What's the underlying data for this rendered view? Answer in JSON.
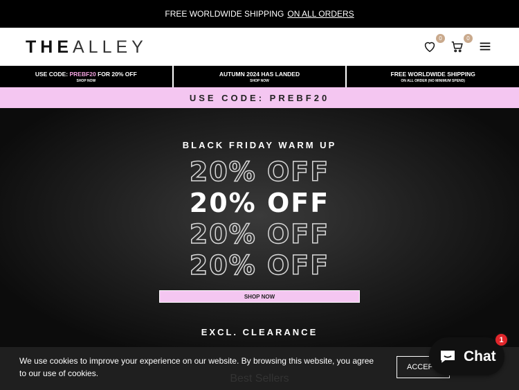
{
  "announcement": {
    "text": "FREE WORLDWIDE SHIPPING",
    "link": "ON ALL ORDERS"
  },
  "header": {
    "logo_bold": "THE",
    "logo_light": "ALLEY",
    "wishlist_count": "0",
    "cart_count": "0"
  },
  "promos": [
    {
      "pre": "USE CODE:",
      "code": "PREBF20",
      "post": "FOR 20% OFF",
      "sub": "SHOP NOW"
    },
    {
      "title": "AUTUMN 2024 HAS LANDED",
      "sub": "SHOP NOW"
    },
    {
      "title": "FREE WORLDWIDE SHIPPING",
      "sub": "ON ALL ORDER (NO MINIMUM SPEND)"
    }
  ],
  "code_banner": "USE CODE: PREBF20",
  "hero": {
    "kicker": "BLACK FRIDAY WARM UP",
    "offer": "20% OFF",
    "cta": "SHOP NOW",
    "footer": "EXCL. CLEARANCE"
  },
  "section_title": "Best Sellers",
  "cookie": {
    "text": "We use cookies to improve your experience on our website. By browsing this website, you agree to our use of cookies.",
    "accept": "ACCEPT"
  },
  "chat": {
    "label": "Chat",
    "badge": "1"
  },
  "colors": {
    "accent_pink": "#f4c6f1",
    "badge_tan": "#c9a98c",
    "chat_badge": "#e0262b"
  }
}
